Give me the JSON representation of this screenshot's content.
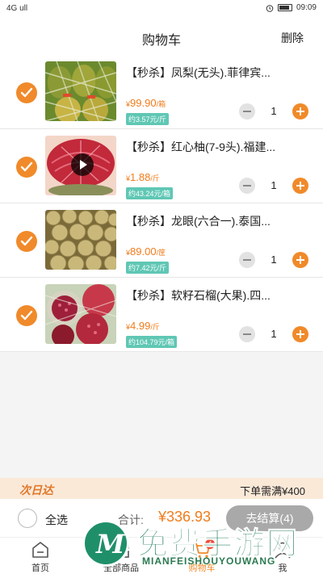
{
  "status": {
    "signal": "4G ull",
    "time": "09:09"
  },
  "header": {
    "title": "购物车",
    "delete_label": "删除"
  },
  "items": [
    {
      "name": "【秒杀】凤梨(无头).菲律宾...",
      "price": "99.90",
      "unit": "/箱",
      "approx": "约3.57元/斤",
      "qty": "1",
      "image": "pineapple-image"
    },
    {
      "name": "【秒杀】红心柚(7-9头).福建...",
      "price": "1.88",
      "unit": "/斤",
      "approx": "约43.24元/箱",
      "qty": "1",
      "image": "pomelo-image"
    },
    {
      "name": "【秒杀】龙眼(六合一).泰国...",
      "price": "89.00",
      "unit": "/筐",
      "approx": "约7.42元/斤",
      "qty": "1",
      "image": "longan-image"
    },
    {
      "name": "【秒杀】软籽石榴(大果).四...",
      "price": "4.99",
      "unit": "/斤",
      "approx": "约104.79元/箱",
      "qty": "1",
      "image": "pomegranate-image"
    }
  ],
  "currency": "¥",
  "delivery": {
    "brand": "次日达",
    "minimum": "下单需满¥400"
  },
  "checkout": {
    "select_all": "全选",
    "total_label": "合计:",
    "total": "¥336.93",
    "settle": "去结算(4)"
  },
  "tabs": [
    {
      "label": "首页",
      "icon": "home-icon"
    },
    {
      "label": "全部商品",
      "icon": "grid-icon"
    },
    {
      "label": "购物车",
      "icon": "cart-icon",
      "badge": "4",
      "active": true
    },
    {
      "label": "我",
      "icon": "user-icon"
    }
  ],
  "watermark": {
    "cn": "免费手游网",
    "en": "MIANFEISHOUYOUWANG",
    "logo": "M"
  },
  "colors": {
    "accent": "#f08a2a",
    "price": "#f07c1c",
    "tag": "#5fc7b4",
    "badge": "#f04b3a"
  }
}
